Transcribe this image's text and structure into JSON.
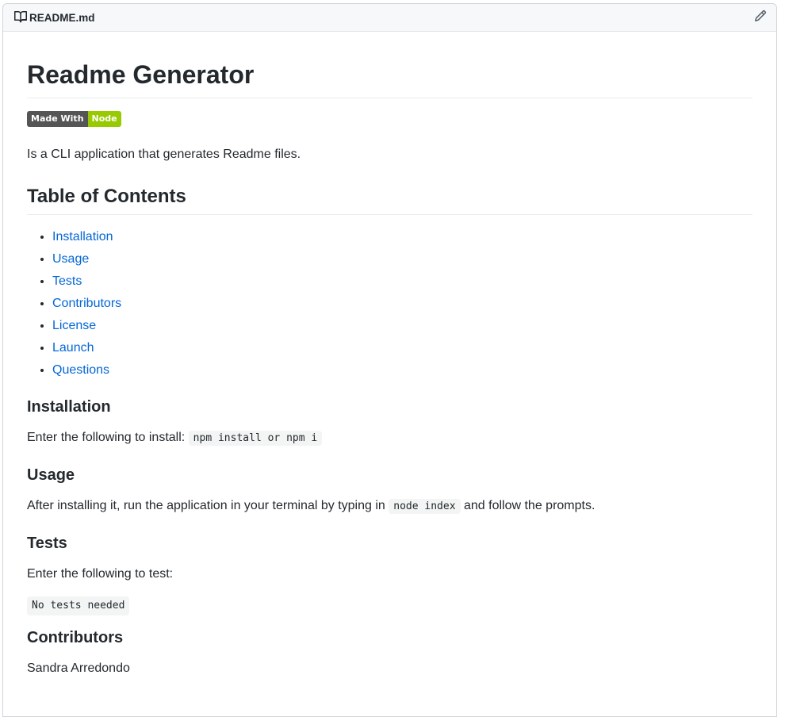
{
  "header": {
    "file_name": "README.md",
    "book_icon": "book-icon",
    "edit_icon": "pencil-icon"
  },
  "readme": {
    "title": "Readme Generator",
    "badge": {
      "left": "Made With",
      "right": "Node",
      "left_color": "#555555",
      "right_color": "#97ca00"
    },
    "intro": "Is a CLI application that generates Readme files.",
    "toc_heading": "Table of Contents",
    "toc": [
      "Installation",
      "Usage",
      "Tests",
      "Contributors",
      "License",
      "Launch",
      "Questions"
    ],
    "installation": {
      "heading": "Installation",
      "text": "Enter the following to install:",
      "code": "npm install or npm i"
    },
    "usage": {
      "heading": "Usage",
      "text_before": "After installing it, run the application in your terminal by typing in",
      "code": "node index",
      "text_after": "and follow the prompts."
    },
    "tests": {
      "heading": "Tests",
      "text": "Enter the following to test:",
      "code": "No tests needed"
    },
    "contributors": {
      "heading": "Contributors",
      "text": "Sandra Arredondo"
    }
  },
  "colors": {
    "link": "#0366d6",
    "text": "#24292e",
    "header_bg": "#f6f8fa"
  }
}
